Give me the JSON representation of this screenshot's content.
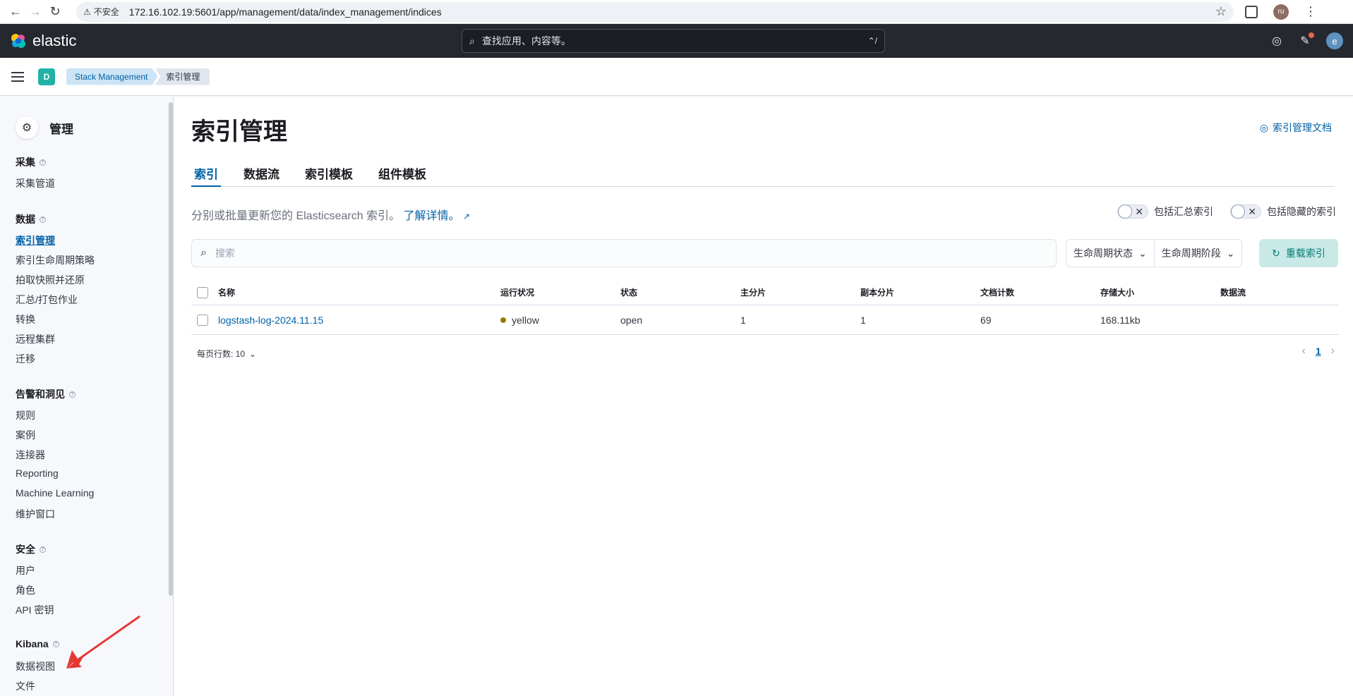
{
  "browser": {
    "security_label": "不安全",
    "url": "172.16.102.19:5601/app/management/data/index_management/indices",
    "profile_initials": "ru"
  },
  "header": {
    "logo_text": "elastic",
    "search_placeholder": "查找应用、内容等。",
    "search_shortcut": "⌃/",
    "user_initial": "e"
  },
  "breadcrumb": {
    "space_initial": "D",
    "items": [
      "Stack Management",
      "索引管理"
    ]
  },
  "sidebar": {
    "title": "管理",
    "groups": [
      {
        "title": "采集",
        "items": [
          "采集管道"
        ]
      },
      {
        "title": "数据",
        "items": [
          "索引管理",
          "索引生命周期策略",
          "拍取快照并还原",
          "汇总/打包作业",
          "转换",
          "远程集群",
          "迁移"
        ]
      },
      {
        "title": "告警和洞见",
        "items": [
          "规则",
          "案例",
          "连接器",
          "Reporting",
          "Machine Learning",
          "维护窗口"
        ]
      },
      {
        "title": "安全",
        "items": [
          "用户",
          "角色",
          "API 密钥"
        ]
      },
      {
        "title": "Kibana",
        "items": [
          "数据视图",
          "文件"
        ]
      }
    ],
    "active_item": "索引管理"
  },
  "main": {
    "title": "索引管理",
    "doc_link": "索引管理文档",
    "tabs": [
      "索引",
      "数据流",
      "索引模板",
      "组件模板"
    ],
    "active_tab": "索引",
    "description": "分别或批量更新您的 Elasticsearch 索引。",
    "learn_more": "了解详情。",
    "toggle_rollup": "包括汇总索引",
    "toggle_hidden": "包括隐藏的索引",
    "search_placeholder": "搜索",
    "filter_lifecycle_status": "生命周期状态",
    "filter_lifecycle_phase": "生命周期阶段",
    "reload_button": "重载索引",
    "table": {
      "columns": [
        "名称",
        "运行状况",
        "状态",
        "主分片",
        "副本分片",
        "文档计数",
        "存储大小",
        "数据流"
      ],
      "rows": [
        {
          "name": "logstash-log-2024.11.15",
          "health": "yellow",
          "status": "open",
          "primary": "1",
          "replicas": "1",
          "docs": "69",
          "size": "168.11kb",
          "data_stream": ""
        }
      ]
    },
    "rows_per_page": "每页行数: 10",
    "current_page": "1"
  },
  "colors": {
    "accent": "#0061a6",
    "header_bg": "#25282f",
    "health_yellow": "#9a7a00",
    "annotation_arrow": "#e53935"
  }
}
